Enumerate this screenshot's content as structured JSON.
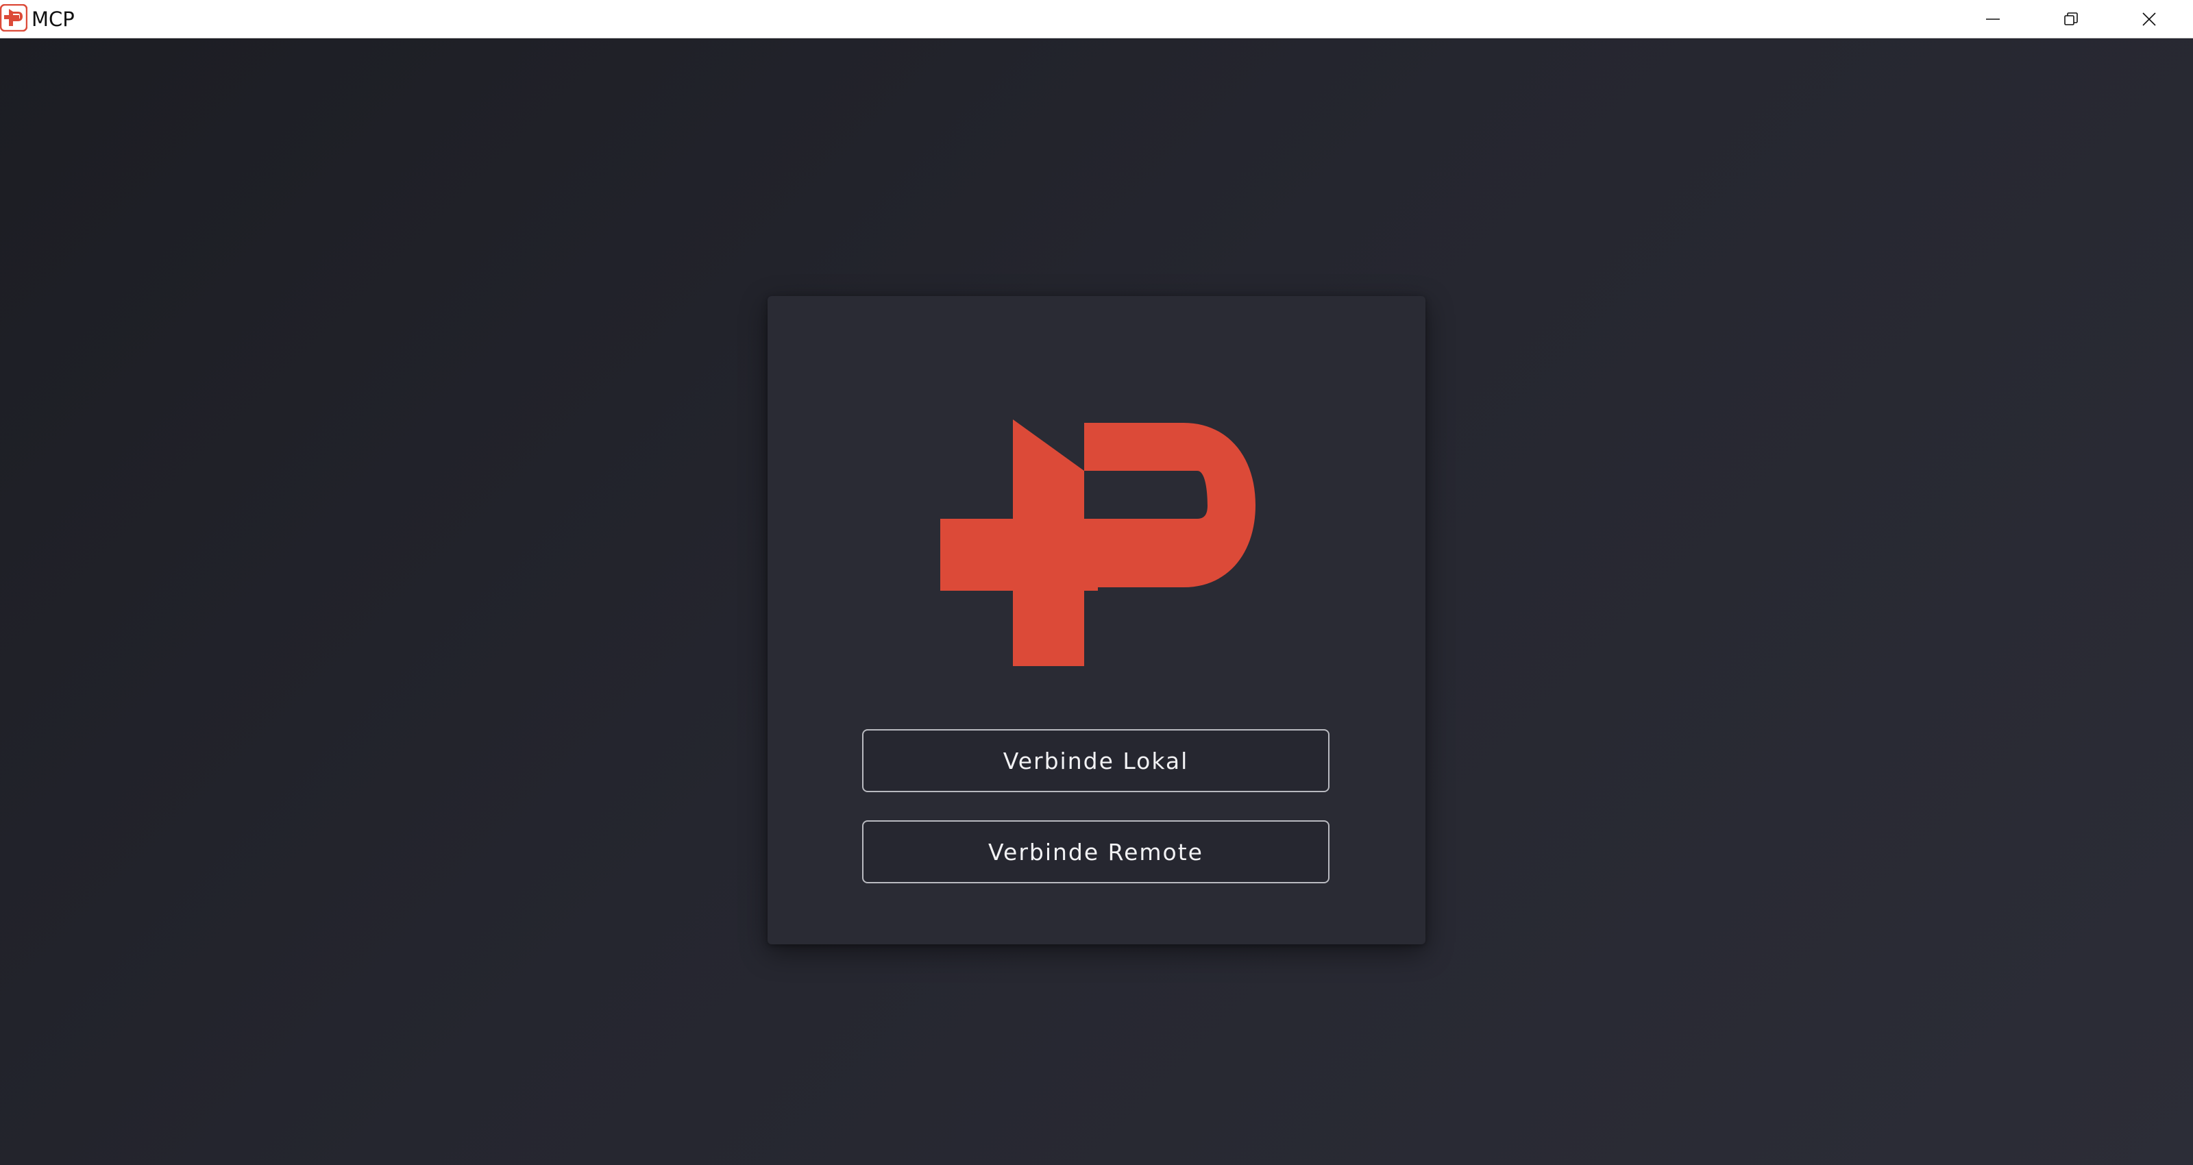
{
  "window": {
    "title": "MCP",
    "app_icon": "mcp-logo-icon",
    "controls": {
      "minimize_icon": "minimize-icon",
      "restore_icon": "restore-icon",
      "close_icon": "close-icon"
    }
  },
  "colors": {
    "brand_red": "#dc4a38",
    "background": "#25262f",
    "card": "#2a2b34",
    "button_border": "#b9bac0",
    "button_text": "#f2f2f4"
  },
  "main": {
    "logo_icon": "mcp-logo",
    "buttons": {
      "local_label": "Verbinde Lokal",
      "remote_label": "Verbinde Remote"
    }
  }
}
